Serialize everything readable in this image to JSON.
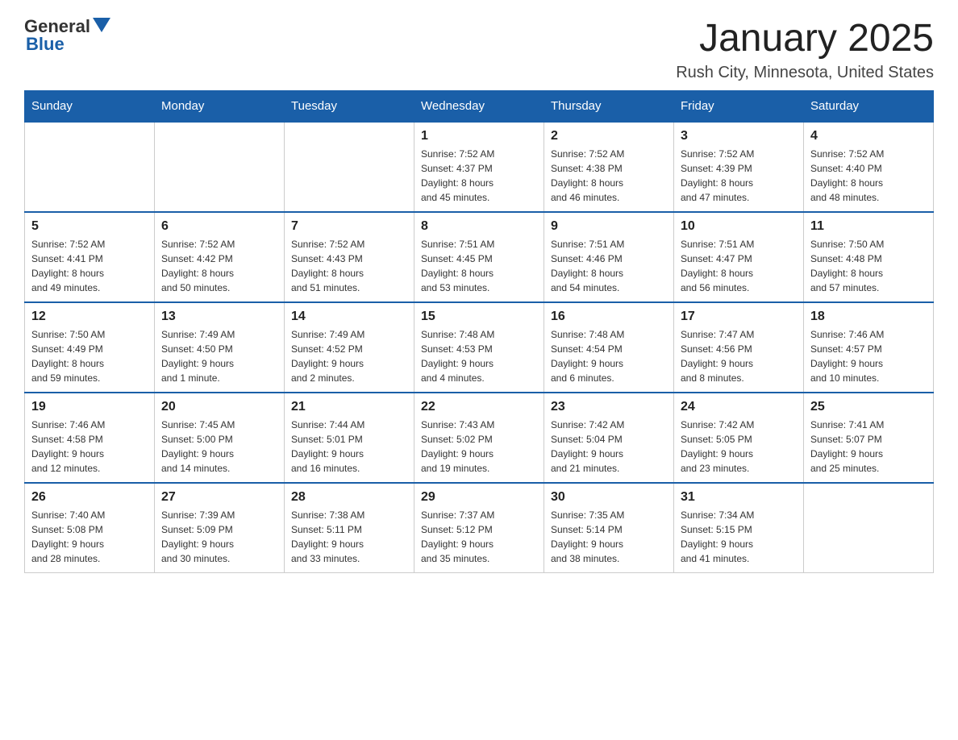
{
  "logo": {
    "text_general": "General",
    "text_blue": "Blue"
  },
  "title": "January 2025",
  "subtitle": "Rush City, Minnesota, United States",
  "days_of_week": [
    "Sunday",
    "Monday",
    "Tuesday",
    "Wednesday",
    "Thursday",
    "Friday",
    "Saturday"
  ],
  "weeks": [
    [
      {
        "day": "",
        "info": ""
      },
      {
        "day": "",
        "info": ""
      },
      {
        "day": "",
        "info": ""
      },
      {
        "day": "1",
        "info": "Sunrise: 7:52 AM\nSunset: 4:37 PM\nDaylight: 8 hours\nand 45 minutes."
      },
      {
        "day": "2",
        "info": "Sunrise: 7:52 AM\nSunset: 4:38 PM\nDaylight: 8 hours\nand 46 minutes."
      },
      {
        "day": "3",
        "info": "Sunrise: 7:52 AM\nSunset: 4:39 PM\nDaylight: 8 hours\nand 47 minutes."
      },
      {
        "day": "4",
        "info": "Sunrise: 7:52 AM\nSunset: 4:40 PM\nDaylight: 8 hours\nand 48 minutes."
      }
    ],
    [
      {
        "day": "5",
        "info": "Sunrise: 7:52 AM\nSunset: 4:41 PM\nDaylight: 8 hours\nand 49 minutes."
      },
      {
        "day": "6",
        "info": "Sunrise: 7:52 AM\nSunset: 4:42 PM\nDaylight: 8 hours\nand 50 minutes."
      },
      {
        "day": "7",
        "info": "Sunrise: 7:52 AM\nSunset: 4:43 PM\nDaylight: 8 hours\nand 51 minutes."
      },
      {
        "day": "8",
        "info": "Sunrise: 7:51 AM\nSunset: 4:45 PM\nDaylight: 8 hours\nand 53 minutes."
      },
      {
        "day": "9",
        "info": "Sunrise: 7:51 AM\nSunset: 4:46 PM\nDaylight: 8 hours\nand 54 minutes."
      },
      {
        "day": "10",
        "info": "Sunrise: 7:51 AM\nSunset: 4:47 PM\nDaylight: 8 hours\nand 56 minutes."
      },
      {
        "day": "11",
        "info": "Sunrise: 7:50 AM\nSunset: 4:48 PM\nDaylight: 8 hours\nand 57 minutes."
      }
    ],
    [
      {
        "day": "12",
        "info": "Sunrise: 7:50 AM\nSunset: 4:49 PM\nDaylight: 8 hours\nand 59 minutes."
      },
      {
        "day": "13",
        "info": "Sunrise: 7:49 AM\nSunset: 4:50 PM\nDaylight: 9 hours\nand 1 minute."
      },
      {
        "day": "14",
        "info": "Sunrise: 7:49 AM\nSunset: 4:52 PM\nDaylight: 9 hours\nand 2 minutes."
      },
      {
        "day": "15",
        "info": "Sunrise: 7:48 AM\nSunset: 4:53 PM\nDaylight: 9 hours\nand 4 minutes."
      },
      {
        "day": "16",
        "info": "Sunrise: 7:48 AM\nSunset: 4:54 PM\nDaylight: 9 hours\nand 6 minutes."
      },
      {
        "day": "17",
        "info": "Sunrise: 7:47 AM\nSunset: 4:56 PM\nDaylight: 9 hours\nand 8 minutes."
      },
      {
        "day": "18",
        "info": "Sunrise: 7:46 AM\nSunset: 4:57 PM\nDaylight: 9 hours\nand 10 minutes."
      }
    ],
    [
      {
        "day": "19",
        "info": "Sunrise: 7:46 AM\nSunset: 4:58 PM\nDaylight: 9 hours\nand 12 minutes."
      },
      {
        "day": "20",
        "info": "Sunrise: 7:45 AM\nSunset: 5:00 PM\nDaylight: 9 hours\nand 14 minutes."
      },
      {
        "day": "21",
        "info": "Sunrise: 7:44 AM\nSunset: 5:01 PM\nDaylight: 9 hours\nand 16 minutes."
      },
      {
        "day": "22",
        "info": "Sunrise: 7:43 AM\nSunset: 5:02 PM\nDaylight: 9 hours\nand 19 minutes."
      },
      {
        "day": "23",
        "info": "Sunrise: 7:42 AM\nSunset: 5:04 PM\nDaylight: 9 hours\nand 21 minutes."
      },
      {
        "day": "24",
        "info": "Sunrise: 7:42 AM\nSunset: 5:05 PM\nDaylight: 9 hours\nand 23 minutes."
      },
      {
        "day": "25",
        "info": "Sunrise: 7:41 AM\nSunset: 5:07 PM\nDaylight: 9 hours\nand 25 minutes."
      }
    ],
    [
      {
        "day": "26",
        "info": "Sunrise: 7:40 AM\nSunset: 5:08 PM\nDaylight: 9 hours\nand 28 minutes."
      },
      {
        "day": "27",
        "info": "Sunrise: 7:39 AM\nSunset: 5:09 PM\nDaylight: 9 hours\nand 30 minutes."
      },
      {
        "day": "28",
        "info": "Sunrise: 7:38 AM\nSunset: 5:11 PM\nDaylight: 9 hours\nand 33 minutes."
      },
      {
        "day": "29",
        "info": "Sunrise: 7:37 AM\nSunset: 5:12 PM\nDaylight: 9 hours\nand 35 minutes."
      },
      {
        "day": "30",
        "info": "Sunrise: 7:35 AM\nSunset: 5:14 PM\nDaylight: 9 hours\nand 38 minutes."
      },
      {
        "day": "31",
        "info": "Sunrise: 7:34 AM\nSunset: 5:15 PM\nDaylight: 9 hours\nand 41 minutes."
      },
      {
        "day": "",
        "info": ""
      }
    ]
  ],
  "colors": {
    "header_bg": "#1a5fa8",
    "header_text": "#ffffff",
    "border": "#cccccc",
    "title_text": "#222222"
  }
}
